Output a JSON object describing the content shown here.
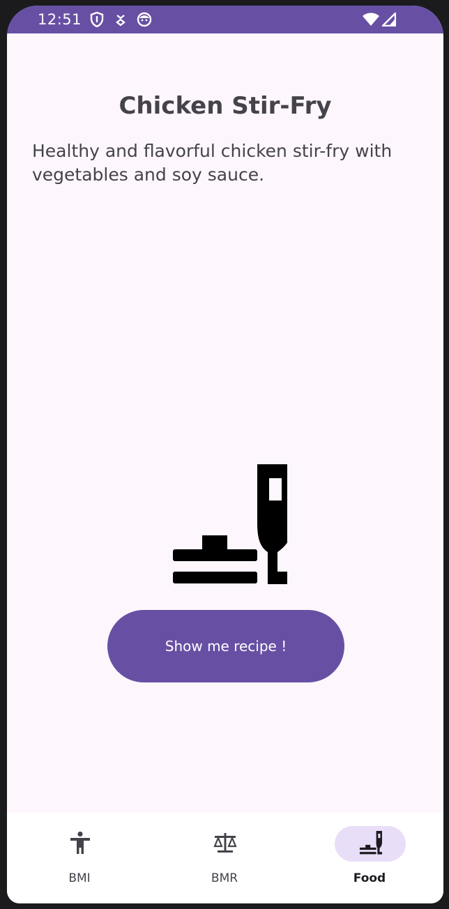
{
  "status_bar": {
    "time": "12:51",
    "icons": [
      "shield-icon",
      "download-icon",
      "face-icon",
      "wifi-icon",
      "cellular-icon"
    ]
  },
  "recipe": {
    "title": "Chicken Stir-Fry",
    "description": "Healthy and flavorful chicken stir-fry with vegetables and soy sauce.",
    "illustration_icon": "dinner-dining-icon",
    "button_label": "Show me recipe !"
  },
  "bottom_nav": {
    "items": [
      {
        "label": "BMI",
        "icon": "accessibility-icon",
        "selected": false
      },
      {
        "label": "BMR",
        "icon": "scale-balance-icon",
        "selected": false
      },
      {
        "label": "Food",
        "icon": "dinner-dining-icon",
        "selected": true
      }
    ]
  },
  "colors": {
    "primary": "#6750a4",
    "background": "#fdf7fd",
    "selected_indicator": "#e8def8",
    "text": "#45424b"
  }
}
